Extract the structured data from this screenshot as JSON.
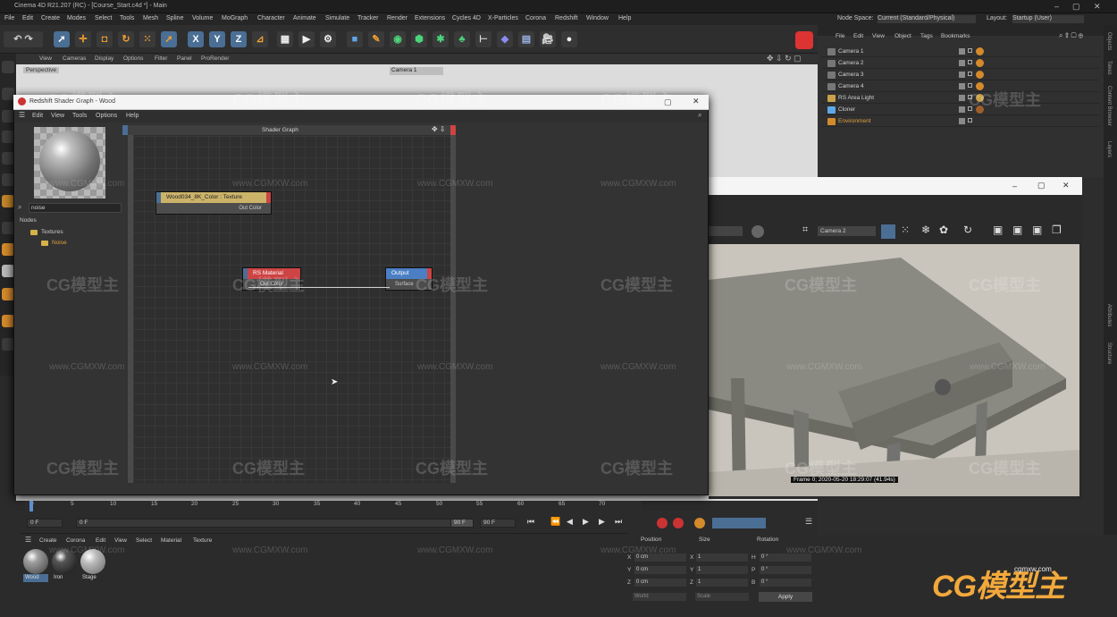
{
  "window": {
    "title": "Cinema 4D R21.207 (RC) - [Course_Start.c4d *] - Main"
  },
  "menu": [
    "File",
    "Edit",
    "Create",
    "Modes",
    "Select",
    "Tools",
    "Mesh",
    "Spline",
    "Volume",
    "MoGraph",
    "Character",
    "Animate",
    "Simulate",
    "Tracker",
    "Render",
    "Extensions",
    "Cycles 4D",
    "X-Particles",
    "Corona",
    "Redshift",
    "Window",
    "Help"
  ],
  "node_space": {
    "label": "Node Space:",
    "value": "Current (Standard/Physical)"
  },
  "layout": {
    "label": "Layout:",
    "value": "Startup (User)"
  },
  "viewport": {
    "menu": [
      "View",
      "Cameras",
      "Display",
      "Options",
      "Filter",
      "Panel",
      "ProRender"
    ],
    "label": "Perspective",
    "camera": "Camera 1"
  },
  "object_manager": {
    "menu": [
      "File",
      "Edit",
      "View",
      "Object",
      "Tags",
      "Bookmarks"
    ],
    "objects": [
      "Camera 1",
      "Camera 2",
      "Camera 3",
      "Camera 4",
      "RS Area Light",
      "Cloner",
      "Environment"
    ]
  },
  "right_tabs": [
    "Objects",
    "Takes",
    "Content Browser",
    "Layers",
    "Attributes",
    "Structure"
  ],
  "shader_graph": {
    "title": "Redshift Shader Graph - Wood",
    "menu": [
      "Edit",
      "View",
      "Tools",
      "Options",
      "Help"
    ],
    "search_value": "noise",
    "nodes_label": "Nodes",
    "tree": {
      "folder": "Textures",
      "item": "Noise"
    },
    "canvas_title": "Shader Graph",
    "nodes": [
      {
        "title": "Wood034_8K_Color : Texture",
        "port": "Out Color"
      },
      {
        "title": "RS Material",
        "port": "Out Color"
      },
      {
        "title": "Output",
        "port": "Surface"
      }
    ]
  },
  "render_view": {
    "camera": "Camera 2",
    "frame_info": "Frame 0; 2020-05-20 18:29:07 (41.94s)"
  },
  "timeline": {
    "ticks": [
      "0",
      "5",
      "10",
      "15",
      "20",
      "25",
      "30",
      "35",
      "40",
      "45",
      "50",
      "55",
      "60",
      "65",
      "70"
    ],
    "start": "0 F",
    "current": "0 F",
    "end_a": "90 F",
    "end_b": "90 F"
  },
  "material_manager": {
    "menu": [
      "Create",
      "Corona",
      "Edit",
      "View",
      "Select",
      "Material",
      "Texture"
    ],
    "materials": [
      "Wood",
      "Iron",
      "Stage"
    ]
  },
  "coordinates": {
    "headers": [
      "Position",
      "Size",
      "Rotation"
    ],
    "rows": [
      {
        "axis": "X",
        "pos": "0 cm",
        "size_axis": "X",
        "size": "1",
        "rot_axis": "H",
        "rot": "0 °"
      },
      {
        "axis": "Y",
        "pos": "0 cm",
        "size_axis": "Y",
        "size": "1",
        "rot_axis": "P",
        "rot": "0 °"
      },
      {
        "axis": "Z",
        "pos": "0 cm",
        "size_axis": "Z",
        "size": "1",
        "rot_axis": "B",
        "rot": "0 °"
      }
    ],
    "mode_a": "World",
    "mode_b": "Scale",
    "apply": "Apply"
  },
  "watermark": {
    "text": "CG模型主",
    "url": "www.CGMXW.com",
    "logo_url": "cgmxw.com"
  }
}
